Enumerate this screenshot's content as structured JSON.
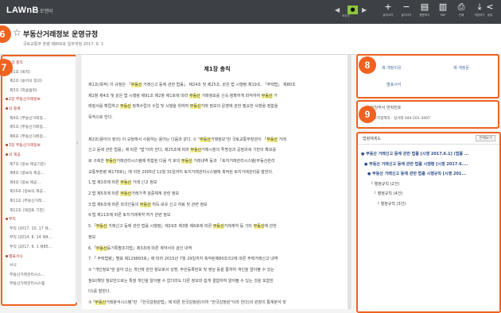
{
  "app": {
    "logo": "LAWnB",
    "logo_sub": "| 로앤비"
  },
  "toolbar": {
    "page_num": "●",
    "page_label": "조우선",
    "buttons": [
      {
        "glyph": "+",
        "label": "글자크기"
      },
      {
        "glyph": "−",
        "label": "글자크기"
      },
      {
        "glyph": "▤",
        "label": "원문보기"
      },
      {
        "glyph": "▥",
        "label": "PDF"
      },
      {
        "glyph": "⎙",
        "label": "인쇄"
      },
      {
        "glyph": "⤓",
        "label": "저장하기"
      },
      {
        "glyph": "<",
        "label": "공유"
      }
    ]
  },
  "doc": {
    "title": "부동산거래정보 운영규정",
    "meta": "국토교통부 훈령 제856호 일부개정 2017. 6. 1"
  },
  "badges": [
    "6",
    "7",
    "8",
    "9"
  ],
  "toc": [
    {
      "t": "1장 총칙",
      "h": true
    },
    {
      "t": "제1조 (목적)",
      "h": false
    },
    {
      "t": "제2조 (용어의 정의)",
      "h": false
    },
    {
      "t": "제3조 (적용범위)",
      "h": false
    },
    {
      "t": "2장 부동산거래정보",
      "h": true
    },
    {
      "t": "의 등록",
      "h": true
    },
    {
      "t": "제4조 (부동산거래정...",
      "h": false
    },
    {
      "t": "제5조 (부동산거래정...",
      "h": false
    },
    {
      "t": "제6조 (부동산거래정...",
      "h": false
    },
    {
      "t": "3장 부동산거래정보",
      "h": true
    },
    {
      "t": "의 제공",
      "h": true
    },
    {
      "t": "제7조 (정보 제공기준)",
      "h": false
    },
    {
      "t": "제8조 (정보의 제공...",
      "h": false
    },
    {
      "t": "제9조 (정보 제공...",
      "h": false
    },
    {
      "t": "제10조 (정보의 제공...",
      "h": false
    },
    {
      "t": "제11조 (부동산거래...",
      "h": false
    },
    {
      "t": "제12조 (재검토 기한)",
      "h": false
    },
    {
      "t": "부칙",
      "h": true
    },
    {
      "t": "부칙 (2017. 10. 17 제...",
      "h": false
    },
    {
      "t": "부칙 (2014. 6. 14 제4...",
      "h": false
    },
    {
      "t": "부칙 (2017. 6. 1 제85...",
      "h": false
    },
    {
      "t": "별표서식",
      "h": true
    },
    {
      "t": "서식",
      "h": false
    },
    {
      "t": "부동산거래관리시스...",
      "h": false
    },
    {
      "t": "부동산거래관리시스템",
      "h": false
    }
  ],
  "article": {
    "title": "제1장 총칙",
    "lines": [
      [
        "제1조(목적) 이 규정은 「",
        "부동산",
        " 거래신고 등에 관한 법률」 제24조 및 제25조, 같은 법 시행령 제19조, 「주택법」 제80조"
      ],
      [
        "제2항 제4조 및 같은 법 시행령 제91조 제2항 제1호에 따라 ",
        "부동산",
        " 거래정보를 신속·정확하게 파악하여 ",
        "부동산",
        " 거"
      ],
      [
        "래질서를 확립하고 ",
        "부동산",
        " 정책수립의 수립 및 시행을 위하여 ",
        "부동산",
        "거래 정보의 운영에 관한 필요한 사항을 정함을"
      ],
      [
        "목적으로 한다."
      ],
      [
        ""
      ],
      [
        "제2조(용어의 정의) 이 규정에서 사용하는 용어는 다음과 같다. ① \"",
        "부동산",
        "거래정보\"란 국토교통부장관이 「",
        "부동산",
        " 거래"
      ],
      [
        "신고 등에 관한 법률」에 따른 \"법\"이라 한다, 제25조에 따라 ",
        "부동산",
        "거래시장의 투명성과 공정과세 기반의 확보를"
      ],
      [
        "로 구축한 ",
        "부동산",
        "거래관리시스템에 취합된 다음 각 호의 ",
        "부동산",
        " 거래내역 등과 「토지거래관리시스템(부동산관리"
      ],
      [
        "교통부훈령 제179호)」에 의한 2005년 12월 31일까지 토지거래관리시스템에 축적된 토지거래관리를 말한다."
      ],
      [
        "1.법 제3조에 따른 ",
        "부동산",
        " 거래 신고 정보"
      ],
      [
        "2.법 제5조에 따른 ",
        "부동산",
        "거래가격 검증체계 관련 정보"
      ],
      [
        "3.법 제6조에 따른 외국인등의 ",
        "부동산",
        " 취득·보유 신고 자료 및 관련 정보"
      ],
      [
        "4.법 제11조에 따른 토지거래계약 허가 관련 정보"
      ],
      [
        "5.「",
        "부동산",
        " 거래신고 등에 관한 법률 시행령」제19조 제3항 제6호에 따른 ",
        "부동산",
        "거래계약 등 기타 ",
        "부동산",
        "에 관한"
      ],
      [
        "정보"
      ],
      [
        "6.「",
        "부동산",
        "등기특별조치법」제3조에 따른 계약서의 검인 내역"
      ],
      [
        "7.「",
        "",
        " 주택법령」별표 제129893호」에 따라 2015년 7월 29일까지 축적된제80조의2에 따른 주택거래신고 내역"
      ],
      [
        "② \"개인정보\"란 살아 있는 개인에 관한 정보로서 성명, 주민등록번호 및 영상 등을 통하여 개인을 알아볼 수 있는"
      ],
      [
        "정보(해당 정보만으로는 특정 개인을 알아볼 수 없더라도 다른 정보와 쉽게 결합하여 알아볼 수 있는 것을 포함한"
      ],
      [
        "다)를 말한다."
      ],
      [
        "③ \"",
        "부동산",
        "거래분석시스템\"란 「한국감정원법」에 따른 한국감정원(이하 \"한국감정원\"이라 한다)의 원장이 통계분석 및"
      ]
    ]
  },
  "panel8": {
    "cells": [
      "제·개정이유",
      "제·개정문",
      "별표서식"
    ]
  },
  "panel9": {
    "label": "담당부서 연락번호",
    "value": "토지정책과 · 실거래 044-201-3407"
  },
  "related": {
    "label": "법령체계도",
    "button": "전체보기",
    "items": [
      {
        "t": "● 부동산 거래신고 등에 관한 법률 [시행 2017.6.1] (법률 ...",
        "b": true
      },
      {
        "t": "● 부동산 거래신고 등에 관한 법률 시행령 [시행 2017.6....",
        "b": true
      },
      {
        "t": "● 부동산 거래신고 등에 관한 법률 시행규칙 [시행 201...",
        "b": true
      },
      {
        "t": "└ 행정규칙 (2건)",
        "b": false
      },
      {
        "t": "└ 행정규칙 (4건)",
        "b": false
      },
      {
        "t": "└ 행정규칙 (3건)",
        "b": false
      }
    ]
  }
}
